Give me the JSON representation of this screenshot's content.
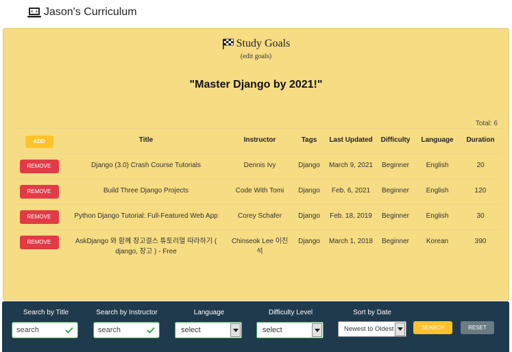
{
  "app": {
    "title": "Jason's Curriculum"
  },
  "goals": {
    "title": "Study Goals",
    "edit_link": "(edit goals)",
    "quote": "\"Master Django by 2021!\"",
    "total": "Total: 6"
  },
  "table": {
    "add_label": "ADD",
    "remove_label": "REMOVE",
    "headers": [
      "Title",
      "Instructor",
      "Tags",
      "Last Updated",
      "Difficulty",
      "Language",
      "Duration"
    ],
    "rows": [
      {
        "title": "Django (3.0) Crash Course Tutorials",
        "instructor": "Dennis Ivy",
        "tags": "Django",
        "updated": "March 9, 2021",
        "difficulty": "Beginner",
        "language": "English",
        "duration": "20"
      },
      {
        "title": "Build Three Django Projects",
        "instructor": "Code With Tomi",
        "tags": "Django",
        "updated": "Feb. 6, 2021",
        "difficulty": "Beginner",
        "language": "English",
        "duration": "120"
      },
      {
        "title": "Python Django Tutorial: Full-Featured Web App",
        "instructor": "Corey Schafer",
        "tags": "Django",
        "updated": "Feb. 18, 2019",
        "difficulty": "Beginner",
        "language": "English",
        "duration": "30"
      },
      {
        "title": "AskDjango 와 함께 장고걸스 튜토리얼 따라하기 ( django, 장고 ) - Free",
        "instructor": "Chinseok Lee 이진석",
        "tags": "Django",
        "updated": "March 1, 2018",
        "difficulty": "Beginner",
        "language": "Korean",
        "duration": "390"
      }
    ]
  },
  "filters": {
    "title_label": "Search by Title",
    "title_placeholder": "search",
    "instructor_label": "Search by Instructor",
    "instructor_placeholder": "search",
    "language_label": "Language",
    "language_value": "select",
    "difficulty_label": "Difficulty Level",
    "difficulty_value": "select",
    "sort_label": "Sort by Date",
    "sort_value": "Newest to Oldest",
    "search_button": "SEARCH",
    "reset_button": "RESET"
  },
  "colors": {
    "panel": "#f6dc83",
    "filter_bar": "#1f3a4c",
    "add_button": "#fec22a",
    "remove_button": "#e23b46",
    "reset_button": "#6b7b84",
    "input_border": "#3aa64b"
  },
  "icons": {
    "app": "laptop-icon",
    "goals": "checkered-flag-icon",
    "valid": "check-icon",
    "dropdown": "triangle-down-icon"
  }
}
